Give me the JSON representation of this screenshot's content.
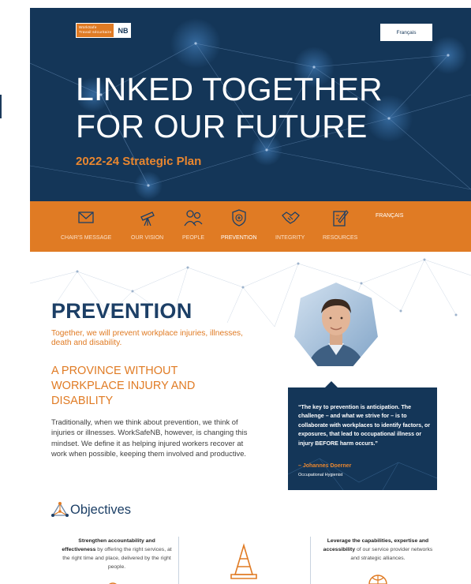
{
  "header": {
    "logo_line1": "WorkSafe",
    "logo_line2": "Travail sécuritaire",
    "logo_nb": "NB",
    "lang_button": "Français",
    "title_line1": "LINKED TOGETHER",
    "title_line2": "FOR OUR FUTURE",
    "subtitle": "2022-24 Strategic Plan"
  },
  "nav": {
    "items": [
      {
        "label": "CHAIR'S MESSAGE",
        "icon": "envelope-icon"
      },
      {
        "label": "OUR VISION",
        "icon": "telescope-icon"
      },
      {
        "label": "PEOPLE",
        "icon": "people-icon"
      },
      {
        "label": "PREVENTION",
        "icon": "shield-plus-icon"
      },
      {
        "label": "INTEGRITY",
        "icon": "handshake-icon"
      },
      {
        "label": "RESOURCES",
        "icon": "document-pencil-icon"
      }
    ],
    "active": "PREVENTION",
    "lang": "FRANÇAIS"
  },
  "section": {
    "title": "PREVENTION",
    "tagline": "Together, we will prevent workplace injuries, illnesses, death and disability.",
    "subheading": "A PROVINCE WITHOUT WORKPLACE INJURY AND DISABILITY",
    "body": "Traditionally, when we think about prevention, we think of injuries or illnesses. WorkSafeNB, however, is changing this mindset. We define it as helping injured workers recover at work when possible, keeping them involved and productive."
  },
  "quote": {
    "text": "“The key to prevention is anticipation. The challenge – and what we strive for – is to collaborate with workplaces to identify factors, or exposures, that lead to occupational illness or injury BEFORE harm occurs.”",
    "author": "– Johannes Doerner",
    "role": "Occupational Hygienist"
  },
  "objectives": {
    "heading": "Objectives",
    "items": [
      {
        "bold": "Strengthen accountability and effectiveness",
        "rest": " by offering the right services, at the right time and place, delivered by the right people."
      },
      {
        "bold": "Leverage the capabilities, expertise and accessibility",
        "rest": " of our service provider networks and strategic alliances."
      }
    ]
  },
  "colors": {
    "navy": "#143658",
    "orange": "#e07b24",
    "title_blue": "#1c3f66"
  }
}
